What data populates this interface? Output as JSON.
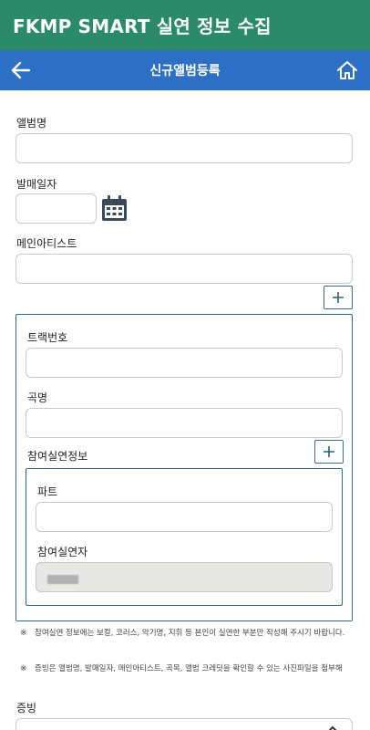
{
  "app": {
    "title": "FKMP SMART 실연 정보 수집"
  },
  "nav": {
    "title": "신규앨범등록",
    "back_icon": "arrow-left-icon",
    "home_icon": "home-icon"
  },
  "form": {
    "album_name_label": "앨범명",
    "release_date_label": "발매일자",
    "main_artist_label": "메인아티스트",
    "track": {
      "number_label": "트랙번호",
      "song_label": "곡명",
      "performer_info_label": "참여실연정보",
      "part_label": "파트",
      "performer_label": "참여실연자"
    },
    "proof_label": "증빙"
  },
  "notes": [
    {
      "mark": "※",
      "text": "참여실연 정보에는 보컬, 코러스, 악기명, 지휘 등 본인이 실연한 부분만 작성해 주시기 바랍니다."
    },
    {
      "mark": "※",
      "text": "증빙은 앨범명, 발매일자, 메인아티스트, 곡목, 앨범 크레딧을 확인할 수 있는 사진파일을 첨부해"
    }
  ],
  "colors": {
    "app_bar": "#2a8a6a",
    "nav_bar": "#2d6fc4",
    "border_accent": "#2f6a85"
  }
}
